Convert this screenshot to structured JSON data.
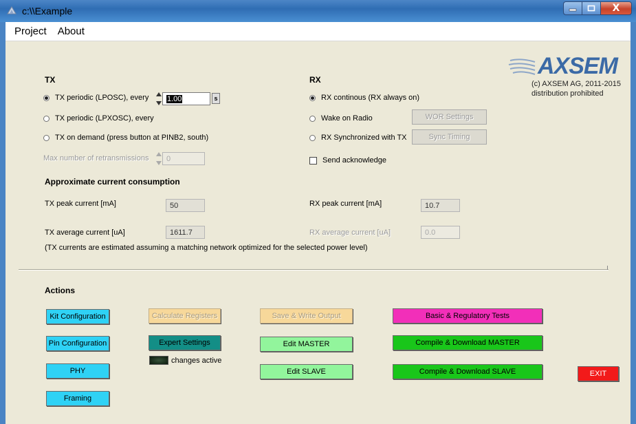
{
  "window": {
    "title": "c:\\\\Example",
    "close_glyph": "X"
  },
  "menu": {
    "items": [
      "Project",
      "About"
    ]
  },
  "logo": {
    "text": "AXSEM",
    "copyright": "(c) AXSEM AG, 2011-2015",
    "notice": "distribution prohibited"
  },
  "tx": {
    "header": "TX",
    "option1": "TX periodic (LPOSC), every",
    "option1_value": "1.00",
    "option1_unit": "s",
    "option2": "TX periodic (LPXOSC), every",
    "option3": "TX on demand (press button at PINB2, south)",
    "retrans_label": "Max number of retransmissions",
    "retrans_value": "0",
    "selected": 1
  },
  "rx": {
    "header": "RX",
    "option1": "RX continous (RX always on)",
    "option2": "Wake on Radio",
    "option3": "RX Synchronized with TX",
    "wor_button": "WOR Settings",
    "sync_button": "Sync Timing",
    "ack_label": "Send acknowledge",
    "ack_checked": false,
    "selected": 1
  },
  "consumption": {
    "header": "Approximate current consumption",
    "tx_peak_label": "TX peak current [mA]",
    "tx_peak_value": "50",
    "tx_avg_label": "TX average current [uA]",
    "tx_avg_value": "1611.7",
    "rx_peak_label": "RX peak current [mA]",
    "rx_peak_value": "10.7",
    "rx_avg_label": "RX average current [uA]",
    "rx_avg_value": "0.0",
    "note": "(TX currents are estimated assuming a matching network optimized for the selected power level)"
  },
  "actions": {
    "header": "Actions",
    "kit_config": "Kit Configuration",
    "pin_config": "Pin Configuration",
    "phy": "PHY",
    "framing": "Framing",
    "calc_registers": "Calculate Registers",
    "expert_settings": "Expert Settings",
    "changes_active": "changes active",
    "save_write": "Save & Write Output",
    "edit_master": "Edit MASTER",
    "edit_slave": "Edit SLAVE",
    "basic_tests": "Basic & Regulatory Tests",
    "compile_master": "Compile & Download MASTER",
    "compile_slave": "Compile & Download SLAVE",
    "exit": "EXIT"
  },
  "colors": {
    "window_bg": "#ece9d8",
    "cyan": "#2fd2f5",
    "teal": "#138e86",
    "light_green": "#92f59c",
    "green": "#19c61a",
    "magenta": "#f22fb9",
    "red": "#f21a1a",
    "logo_blue": "#3b6aa6"
  }
}
